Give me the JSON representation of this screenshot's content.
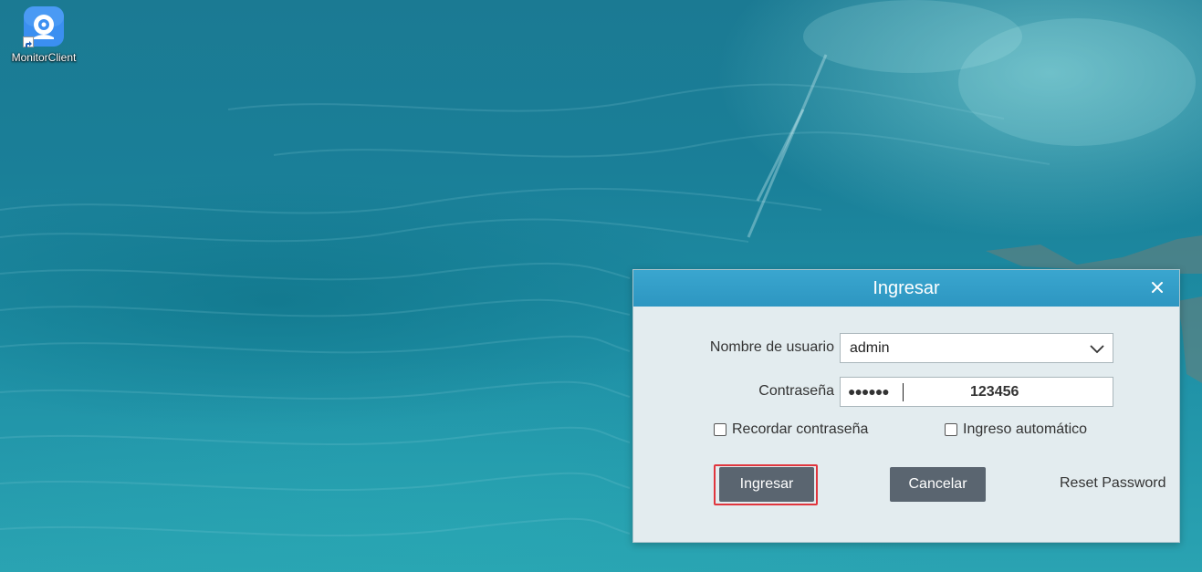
{
  "desktop": {
    "icon_label": "MonitorClient",
    "icon_name": "monitor-client-app-icon"
  },
  "dialog": {
    "title": "Ingresar",
    "close_symbol": "✕",
    "username_label": "Nombre de usuario",
    "username_value": "admin",
    "password_label": "Contraseña",
    "password_masked": "●●●●●●",
    "password_overlay": "123456",
    "remember_label": "Recordar contraseña",
    "remember_checked": false,
    "auto_login_label": "Ingreso automático",
    "auto_login_checked": false,
    "login_button": "Ingresar",
    "cancel_button": "Cancelar",
    "reset_link": "Reset Password"
  },
  "colors": {
    "header": "#3aa6cf",
    "button": "#5a6570",
    "highlight": "#e0353d",
    "dialog_bg": "#e3ecef"
  }
}
